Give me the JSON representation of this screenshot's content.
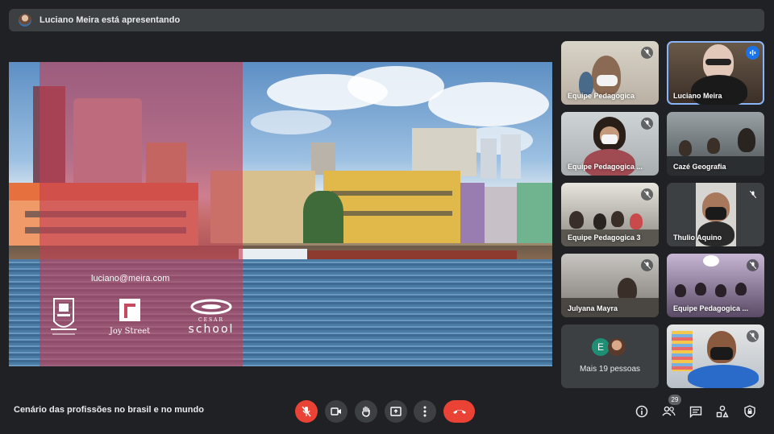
{
  "banner": {
    "presenter_text": "Luciano Meira está apresentando"
  },
  "slide": {
    "email": "luciano@meira.com",
    "logos": {
      "joy_street": "Joy Street",
      "cesar_school_top": "CESAR",
      "cesar_school": "school"
    }
  },
  "participants": [
    {
      "name": "Equipe Pedagogica"
    },
    {
      "name": "Luciano Meira"
    },
    {
      "name": "Equipe Pedagogica ..."
    },
    {
      "name": "Cazé Geografia"
    },
    {
      "name": "Equipe Pedagogica 3"
    },
    {
      "name": "Thulio Aquino"
    },
    {
      "name": "Julyana Mayra"
    },
    {
      "name": "Equipe Pedagogica ..."
    },
    {
      "avatar_letter": "E",
      "label": "Mais 19 pessoas"
    },
    {
      "name": ""
    }
  ],
  "bottom_bar": {
    "meeting_title": "Cenário das profissões no brasil e no mundo",
    "participant_count": "29"
  },
  "colors": {
    "background": "#202124",
    "danger": "#ea4335",
    "speaking": "#1a73e8"
  }
}
